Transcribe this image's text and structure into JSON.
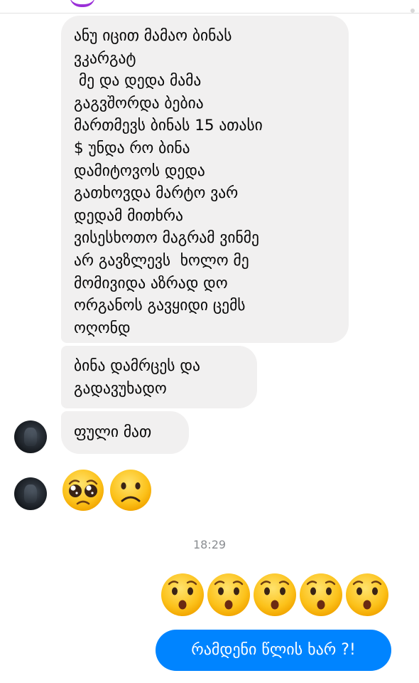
{
  "messages": {
    "incoming_1": "ანუ იცით მამაო ბინას\nვკარგატ\n მე და დედა მამა\nგაგვშორდა ბებია\nმართმევს ბინას 15 ათასი\n$ უნდა რო ბინა\nდამიტოვოს დედა\nგათხოვდა მარტო ვარ\nდედამ მითხრა\nვისესხოთო მაგრამ ვინმე\nარ გავზლევს  ხოლო მე\nმომივიდა აზრად დო\nორგანოს გავყიდი ცემს\nოღონდ",
    "incoming_2": "ბინა დამრცეს და\nგადავუხადო",
    "incoming_3": "ფული მათ",
    "incoming_emojis": [
      "pleading-face",
      "frowning-face"
    ],
    "timestamp": "18:29",
    "outgoing_emojis": [
      "hushed-face",
      "hushed-face",
      "hushed-face",
      "hushed-face",
      "hushed-face"
    ],
    "outgoing_text": "რამდენი წლის ხარ ?!"
  },
  "colors": {
    "incoming_bubble": "#f1f0f0",
    "outgoing_bubble": "#0084ff",
    "timestamp": "#8a8d91"
  }
}
